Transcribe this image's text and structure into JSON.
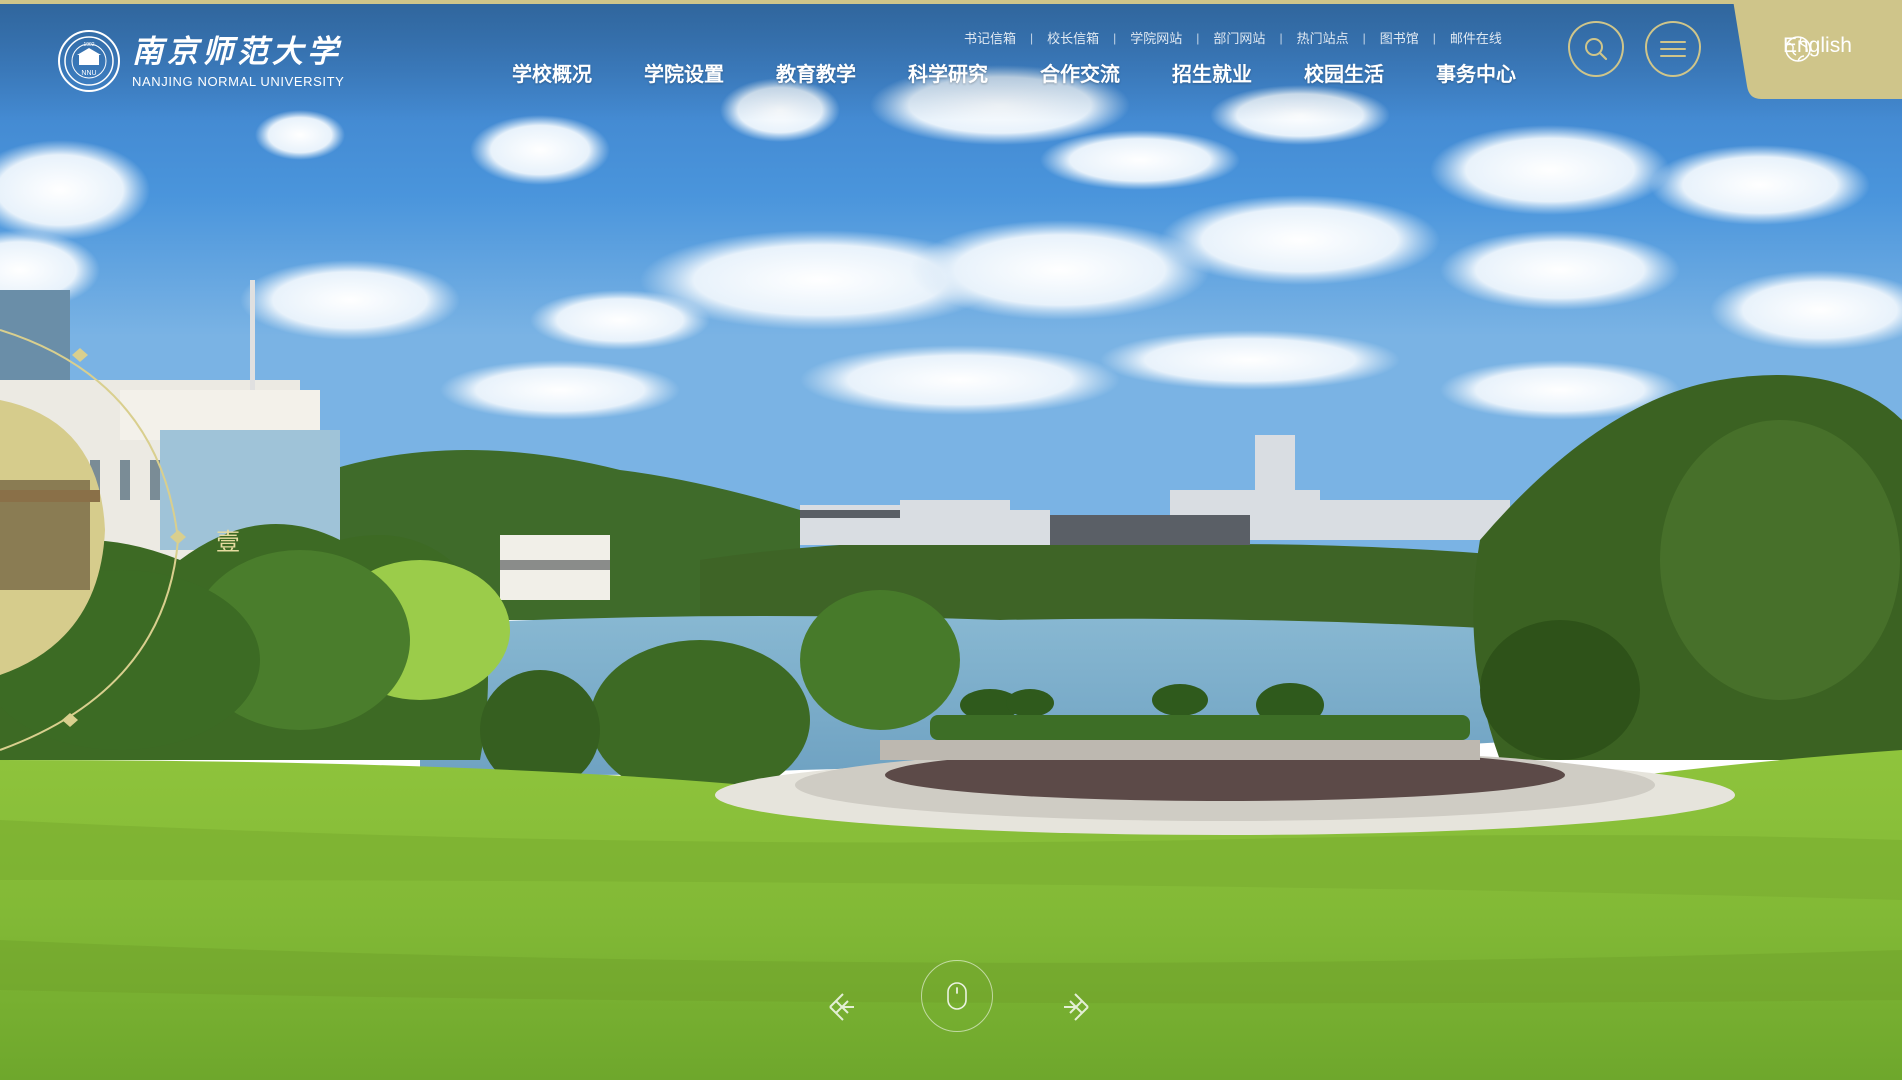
{
  "site": {
    "name_cn": "南京师范大学",
    "name_en": "NANJING NORMAL UNIVERSITY",
    "seal_text": "NNU",
    "seal_year": "1902"
  },
  "quick_links": [
    "书记信箱",
    "校长信箱",
    "学院网站",
    "部门网站",
    "热门站点",
    "图书馆",
    "邮件在线"
  ],
  "quick_link_separator": "|",
  "main_nav": [
    "学校概况",
    "学院设置",
    "教育教学",
    "科学研究",
    "合作交流",
    "招生就业",
    "校园生活",
    "事务中心"
  ],
  "language_switch": {
    "label": "English",
    "icon": "globe-icon"
  },
  "header_icons": {
    "search": "search-icon",
    "menu": "hamburger-menu-icon"
  },
  "hero": {
    "dial_char": "壹",
    "scroll_icon": "mouse-scroll-icon",
    "prev_icon": "knot-arrow-left-icon",
    "next_icon": "knot-arrow-right-icon"
  },
  "colors": {
    "accent_gold": "#cfc58a",
    "header_blue": "#3a78b4",
    "grass": "#8cc63a"
  }
}
